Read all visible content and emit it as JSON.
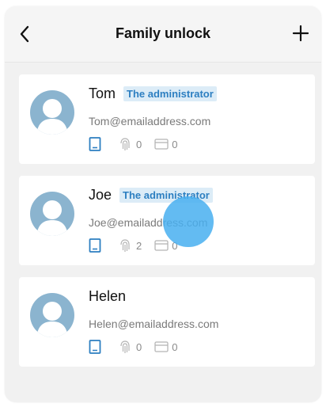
{
  "header": {
    "title": "Family unlock",
    "back_icon": "chevron-left-icon",
    "add_icon": "plus-icon"
  },
  "members": [
    {
      "name": "Tom",
      "badge": "The administrator",
      "email": "Tom@emailaddress.com",
      "fingerprints": "0",
      "cards": "0"
    },
    {
      "name": "Joe",
      "badge": "The administrator",
      "email": "Joe@emailaddress.com",
      "fingerprints": "2",
      "cards": "0"
    },
    {
      "name": "Helen",
      "badge": "",
      "email": "Helen@emailaddress.com",
      "fingerprints": "0",
      "cards": "0"
    }
  ],
  "colors": {
    "accent": "#2d7fc1",
    "badge_bg": "#dcecf7",
    "avatar": "#8bb4cf",
    "touch": "#48aff0"
  }
}
